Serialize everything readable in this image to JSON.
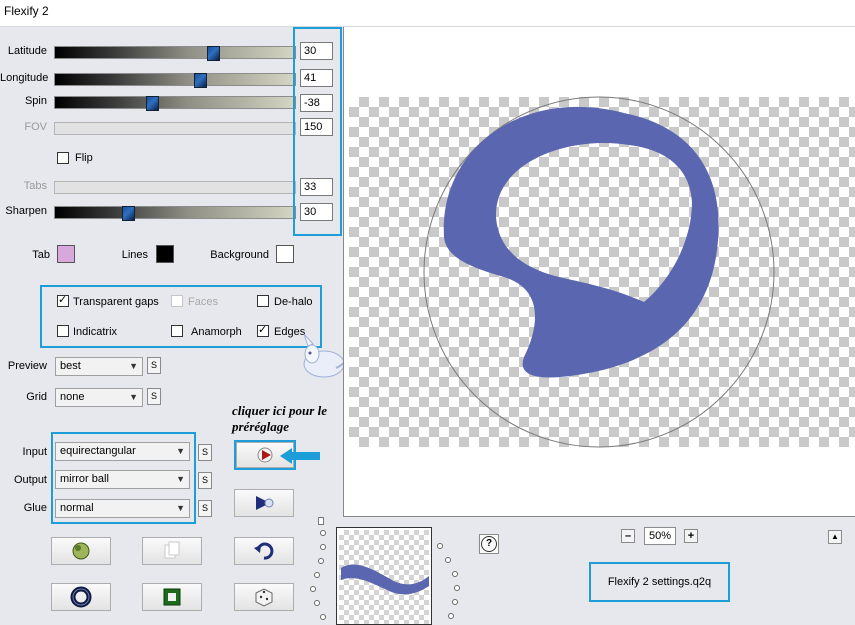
{
  "window": {
    "title": "Flexify 2"
  },
  "sliders": [
    {
      "label": "Latitude",
      "value": "30",
      "level": 0.65,
      "disabled": false
    },
    {
      "label": "Longitude",
      "value": "41",
      "level": 0.6,
      "disabled": false
    },
    {
      "label": "Spin",
      "value": "-38",
      "level": 0.4,
      "disabled": false
    },
    {
      "label": "FOV",
      "value": "150",
      "level": null,
      "disabled": true
    },
    {
      "label": "Tabs",
      "value": "33",
      "level": null,
      "disabled": true
    },
    {
      "label": "Sharpen",
      "value": "30",
      "level": 0.3,
      "disabled": false
    }
  ],
  "flip": {
    "label": "Flip",
    "checked": false
  },
  "colors": {
    "tab": {
      "label": "Tab",
      "hex": "#d8a8dc"
    },
    "lines": {
      "label": "Lines",
      "hex": "#000000"
    },
    "background": {
      "label": "Background",
      "hex": "#ffffff"
    },
    "highlight": "#1d9ed8",
    "shape": "#5a66b0"
  },
  "options": {
    "transparent_gaps": {
      "label": "Transparent gaps",
      "checked": true
    },
    "faces": {
      "label": "Faces",
      "checked": false,
      "disabled": true
    },
    "de_halo": {
      "label": "De-halo",
      "checked": false
    },
    "indicatrix": {
      "label": "Indicatrix",
      "checked": false
    },
    "anamorph": {
      "label": "Anamorph",
      "checked": false
    },
    "edges": {
      "label": "Edges",
      "checked": true
    }
  },
  "preview": {
    "label": "Preview",
    "value": "best",
    "s": "S"
  },
  "grid": {
    "label": "Grid",
    "value": "none",
    "s": "S"
  },
  "input": {
    "label": "Input",
    "value": "equirectangular",
    "s": "S"
  },
  "output": {
    "label": "Output",
    "value": "mirror ball",
    "s": "S"
  },
  "glue": {
    "label": "Glue",
    "value": "normal",
    "s": "S"
  },
  "annotation": {
    "line1": "cliquer ici pour le",
    "line2": "préréglage"
  },
  "zoom": {
    "minus": "–",
    "value": "50%",
    "plus": "+"
  },
  "help": "?",
  "collapse": "▲",
  "preset_file": "Flexify 2 settings.q2q",
  "icons": [
    "preset-icon",
    "ball-icon",
    "copy-icon",
    "undo-icon",
    "play-icon",
    "ring-icon",
    "frame-icon",
    "dice-icon",
    "arrow-icon",
    "watermark-icon"
  ]
}
